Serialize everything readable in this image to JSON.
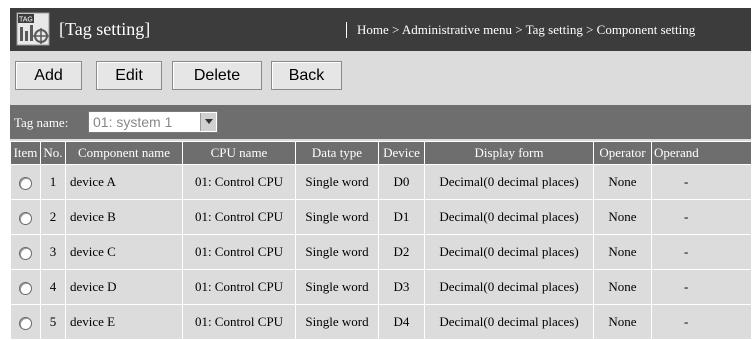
{
  "header": {
    "title": "[Tag setting]",
    "breadcrumb": "Home > Administrative menu > Tag setting > Component setting",
    "icon": "tag-setting-icon",
    "icon_label": "TAG"
  },
  "toolbar": {
    "add_label": "Add",
    "edit_label": "Edit",
    "delete_label": "Delete",
    "back_label": "Back"
  },
  "tag_filter": {
    "label": "Tag name:",
    "selected": "01: system 1"
  },
  "table": {
    "columns": [
      "Item",
      "No.",
      "Component name",
      "CPU name",
      "Data type",
      "Device",
      "Display form",
      "Operator",
      "Operand"
    ],
    "rows": [
      {
        "no": "1",
        "component": "device A",
        "cpu": "01: Control CPU",
        "data_type": "Single word",
        "device": "D0",
        "display_form": "Decimal(0 decimal places)",
        "operator": "None",
        "operand": "-"
      },
      {
        "no": "2",
        "component": "device B",
        "cpu": "01: Control CPU",
        "data_type": "Single word",
        "device": "D1",
        "display_form": "Decimal(0 decimal places)",
        "operator": "None",
        "operand": "-"
      },
      {
        "no": "3",
        "component": "device C",
        "cpu": "01: Control CPU",
        "data_type": "Single word",
        "device": "D2",
        "display_form": "Decimal(0 decimal places)",
        "operator": "None",
        "operand": "-"
      },
      {
        "no": "4",
        "component": "device D",
        "cpu": "01: Control CPU",
        "data_type": "Single word",
        "device": "D3",
        "display_form": "Decimal(0 decimal places)",
        "operator": "None",
        "operand": "-"
      },
      {
        "no": "5",
        "component": "device E",
        "cpu": "01: Control CPU",
        "data_type": "Single word",
        "device": "D4",
        "display_form": "Decimal(0 decimal places)",
        "operator": "None",
        "operand": "-"
      }
    ]
  }
}
